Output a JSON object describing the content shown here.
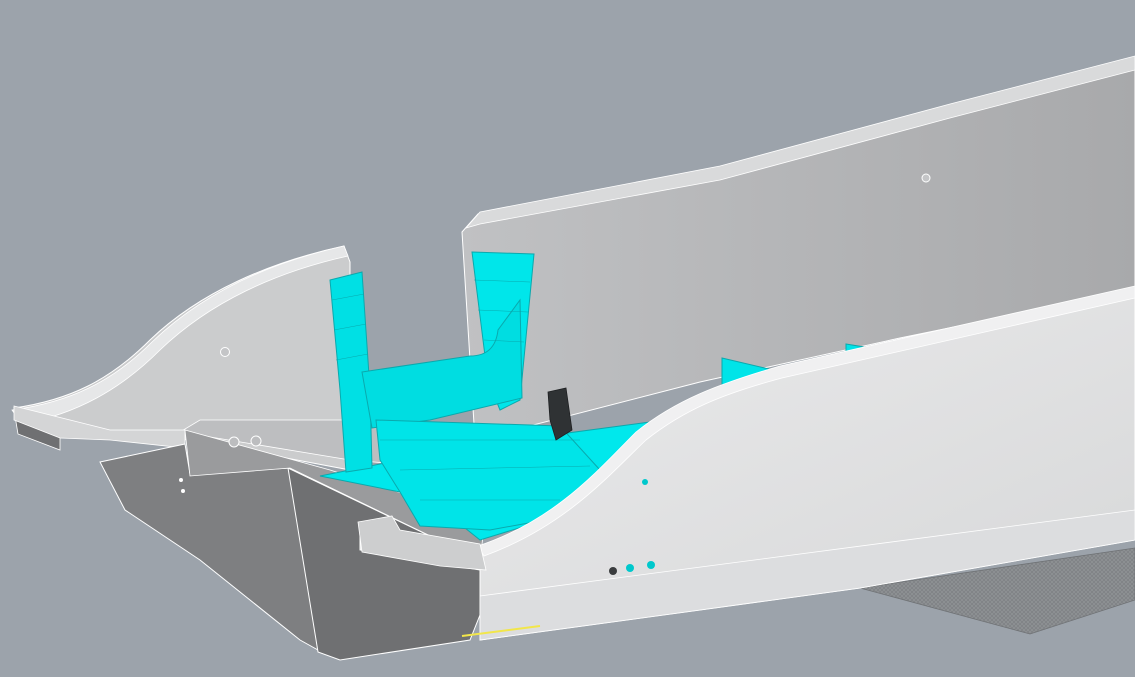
{
  "viewport": {
    "background_color": "#9ca3ab"
  },
  "model": {
    "colors": {
      "shell_light": "#e4e5e6",
      "shell_mid": "#cfd0d2",
      "inner_wall": "#b9babc",
      "inner_wall_dark": "#a9aaac",
      "end_panel_dark": "#7b7c7e",
      "highlight_cyan": "#00e8ec",
      "cyan_edge": "#0aa9ad",
      "dark_part": "#2f3234",
      "mesh_gray": "#85888b",
      "accent_yellow": "#f2e64a",
      "edge_line": "#ffffff"
    },
    "icons": {
      "mount_hole": "circle-outline-icon",
      "fastener": "dot-icon"
    }
  }
}
